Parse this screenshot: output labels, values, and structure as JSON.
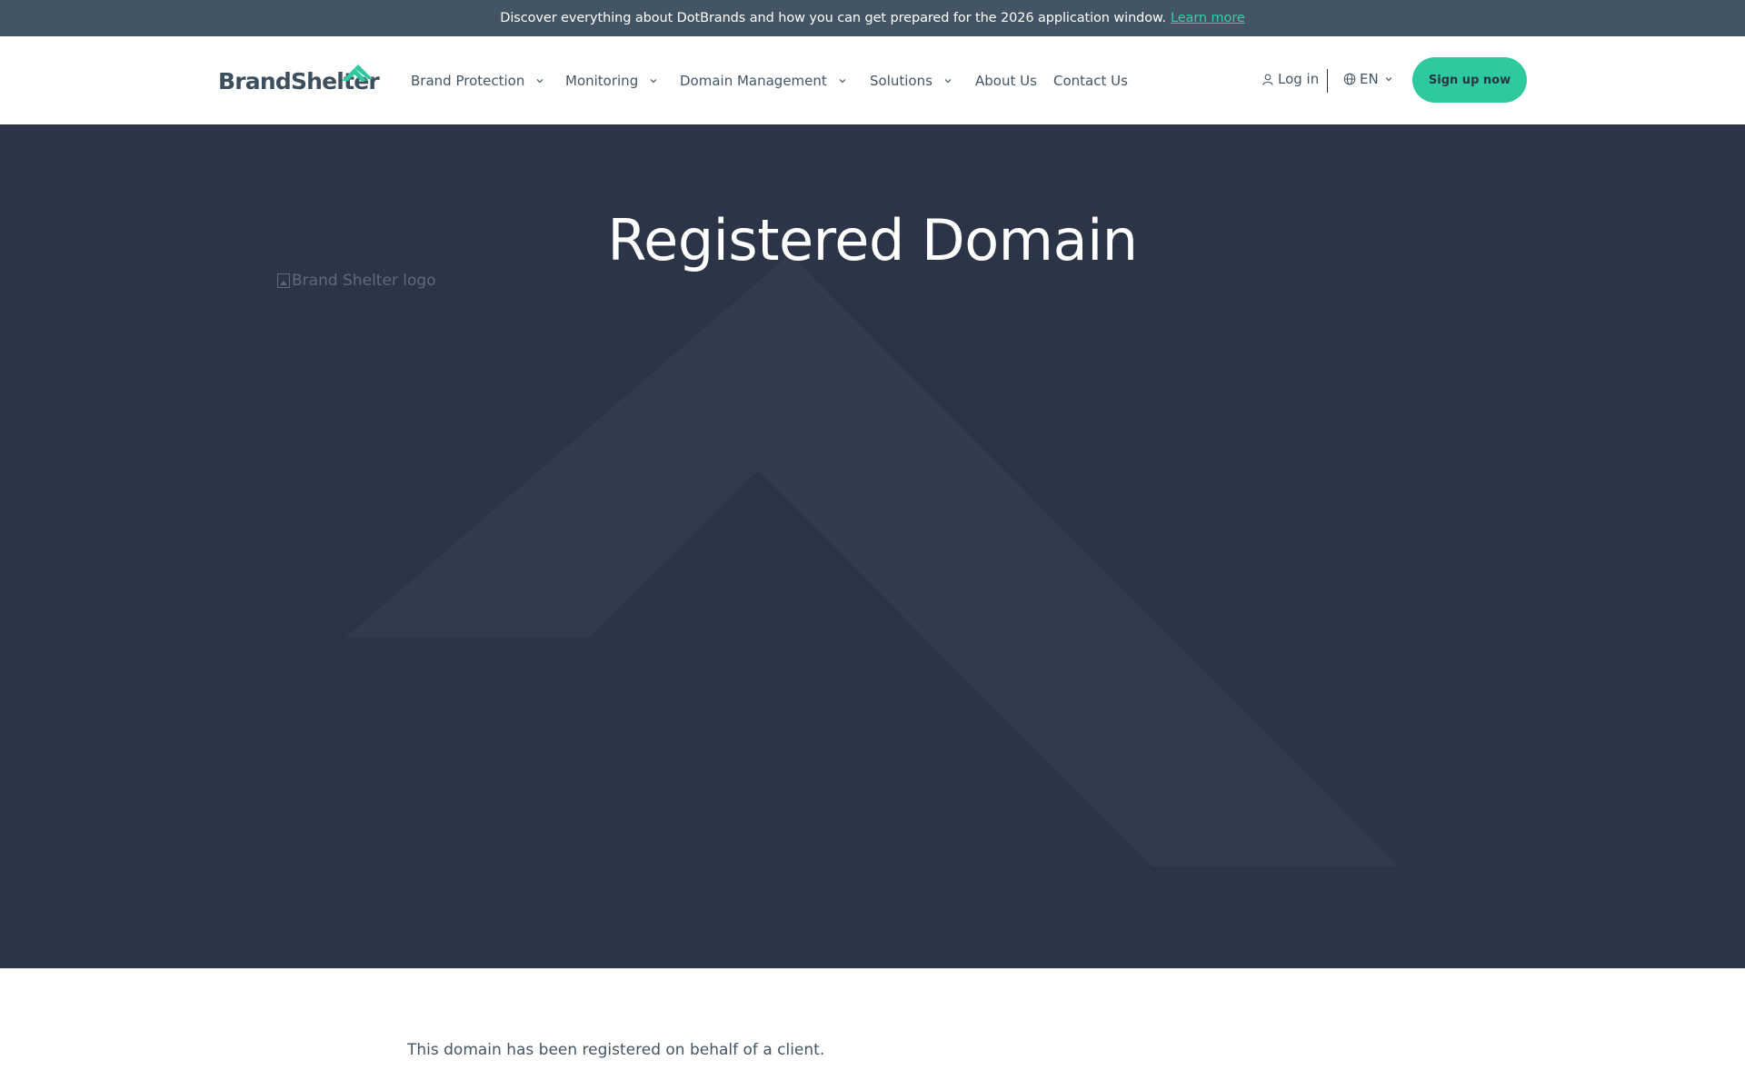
{
  "announcement": {
    "text": "Discover everything about DotBrands and how you can get prepared for the 2026 application window.",
    "link_label": "Learn more"
  },
  "header": {
    "logo_text": "BrandShelter",
    "nav": [
      {
        "label": "Brand Protection",
        "has_dropdown": true
      },
      {
        "label": "Monitoring",
        "has_dropdown": true
      },
      {
        "label": "Domain Management",
        "has_dropdown": true
      },
      {
        "label": "Solutions",
        "has_dropdown": true
      },
      {
        "label": "About Us",
        "has_dropdown": false
      },
      {
        "label": "Contact Us",
        "has_dropdown": false
      }
    ],
    "login_label": "Log in",
    "language": "EN",
    "signup_label": "Sign up now"
  },
  "hero": {
    "title": "Registered Domain",
    "image_alt": "Brand Shelter logo"
  },
  "content": {
    "text": "This domain has been registered on behalf of a client."
  },
  "colors": {
    "announcement_bg": "#435564",
    "accent": "#2ec99e",
    "hero_bg": "#2c3547",
    "text": "#435564"
  }
}
